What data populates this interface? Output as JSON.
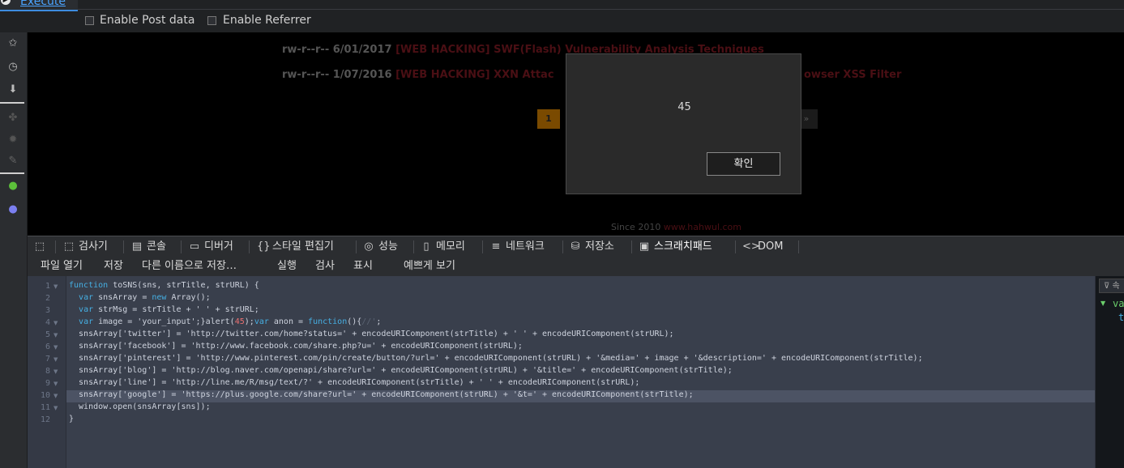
{
  "toolbar": {
    "execute_label": "Execute",
    "enable_post_data": "Enable Post data",
    "enable_referrer": "Enable Referrer"
  },
  "page": {
    "posts": [
      {
        "meta": "rw-r--r-- 6/01/2017",
        "title": "[WEB HACKING] SWF(Flash) Vulnerability Analysis Techniques"
      },
      {
        "meta": "rw-r--r-- 1/07/2016",
        "title": "[WEB HACKING] XXN Attac",
        "title_tail": "owser XSS Filter"
      }
    ],
    "pager_current": "1",
    "pager_next": "»",
    "footer_since": "Since 2010",
    "footer_link": "www.hahwul.com"
  },
  "dialog": {
    "message": "45",
    "ok_label": "확인"
  },
  "devtools": {
    "tabs": [
      "검사기",
      "콘솔",
      "디버거",
      "스타일 편집기",
      "성능",
      "메모리",
      "네트워크",
      "저장소",
      "스크래치패드",
      "DOM"
    ],
    "tab_icons": [
      "⬚",
      "▤",
      "▭",
      "{}",
      "◎",
      "▯",
      "≡",
      "⛁",
      "▣",
      "<>"
    ],
    "active_tab": "스크래치패드"
  },
  "scratchpad": {
    "menu": [
      "파일 열기",
      "저장",
      "다른 이름으로 저장…",
      "실행",
      "검사",
      "표시",
      "예쁘게 보기"
    ]
  },
  "editor": {
    "highlighted_line": 10,
    "line_numbers": [
      "1",
      "2",
      "3",
      "4",
      "5",
      "6",
      "7",
      "8",
      "9",
      "10",
      "11",
      "12"
    ],
    "lines": [
      "function toSNS(sns, strTitle, strURL) {",
      "  var snsArray = new Array();",
      "  var strMsg = strTitle + ' ' + strURL;",
      "  var image = 'your_input';}alert(45);var anon = function(){//';",
      "  snsArray['twitter'] = 'http://twitter.com/home?status=' + encodeURIComponent(strTitle) + ' ' + encodeURIComponent(strURL);",
      "  snsArray['facebook'] = 'http://www.facebook.com/share.php?u=' + encodeURIComponent(strURL);",
      "  snsArray['pinterest'] = 'http://www.pinterest.com/pin/create/button/?url=' + encodeURIComponent(strURL) + '&media=' + image + '&description=' + encodeURIComponent(strTitle);",
      "  snsArray['blog'] = 'http://blog.naver.com/openapi/share?url=' + encodeURIComponent(strURL) + '&title=' + encodeURIComponent(strTitle);",
      "  snsArray['line'] = 'http://line.me/R/msg/text/?' + encodeURIComponent(strTitle) + ' ' + encodeURIComponent(strURL);",
      "  snsArray['google'] = 'https://plus.google.com/share?url=' + encodeURIComponent(strURL) + '&t=' + encodeURIComponent(strTitle);",
      "  window.open(snsArray[sns]);",
      "}"
    ]
  },
  "right_panel": {
    "filter_placeholder": "속",
    "var_text": "va",
    "child_text": "t"
  },
  "colors": {
    "accent": "#3d8ce0",
    "dialog_bg": "#2a2a2a",
    "editor_bg": "#393f4c",
    "keyword": "#46afe3",
    "number": "#eb7070"
  }
}
